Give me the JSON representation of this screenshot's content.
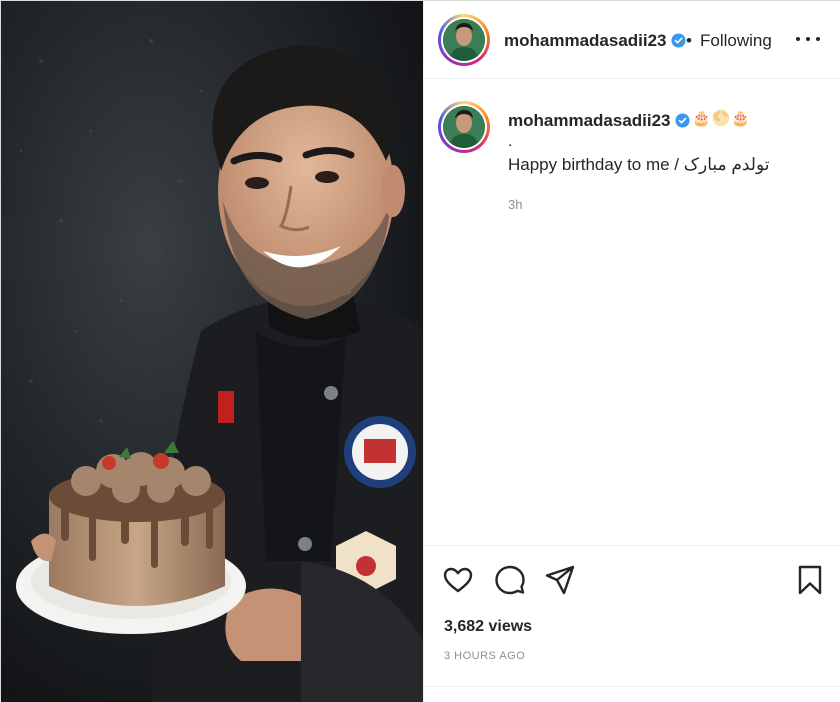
{
  "post": {
    "username": "mohammadasadii23",
    "verified": true,
    "separator": "•",
    "follow_status": "Following",
    "more_icon": "more-horizontal-icon",
    "caption": {
      "username": "mohammadasadii23",
      "emoji": "🎂🌕🎂",
      "line1": ".",
      "text": "Happy birthday to me / تولدم مبارک",
      "time": "3h"
    },
    "actions": {
      "like_icon": "heart-icon",
      "comment_icon": "comment-icon",
      "share_icon": "share-icon",
      "save_icon": "bookmark-icon"
    },
    "views": "3,682 views",
    "posted_ago": "3 HOURS AGO"
  },
  "colors": {
    "verified_blue": "#3897f0",
    "text": "#262626",
    "muted": "#8e8e8e",
    "border": "#dbdbdb"
  }
}
